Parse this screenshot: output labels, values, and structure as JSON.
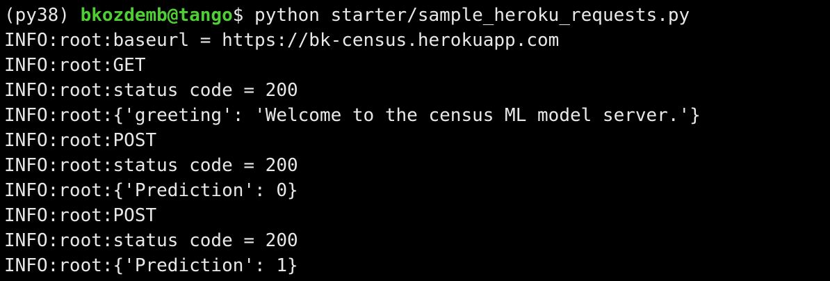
{
  "terminal": {
    "prompt": {
      "env": "(py38) ",
      "user_host": "bkozdemb@tango",
      "symbol": "$",
      "command": " python starter/sample_heroku_requests.py"
    },
    "output": [
      "INFO:root:baseurl = https://bk-census.herokuapp.com",
      "INFO:root:GET",
      "INFO:root:status code = 200",
      "INFO:root:{'greeting': 'Welcome to the census ML model server.'}",
      "INFO:root:POST",
      "INFO:root:status code = 200",
      "INFO:root:{'Prediction': 0}",
      "INFO:root:POST",
      "INFO:root:status code = 200",
      "INFO:root:{'Prediction': 1}"
    ]
  },
  "colors": {
    "background": "#000000",
    "text": "#e8e8e8",
    "prompt_user": "#4fcf33"
  }
}
